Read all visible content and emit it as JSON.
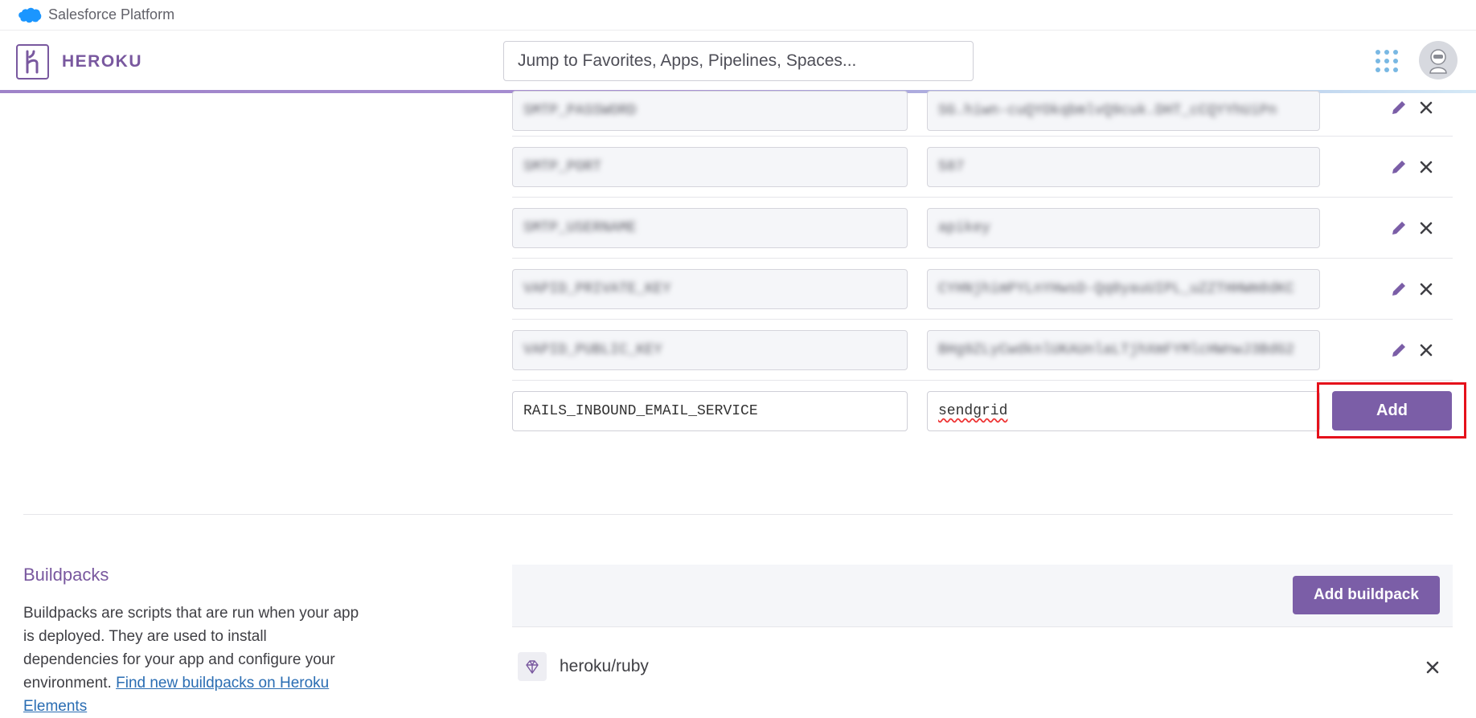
{
  "platform_bar": {
    "label": "Salesforce Platform",
    "icon": "salesforce-cloud-icon"
  },
  "header": {
    "brand": "HEROKU",
    "search_placeholder": "Jump to Favorites, Apps, Pipelines, Spaces...",
    "apps_icon": "apps-grid-icon",
    "avatar_icon": "user-avatar-icon"
  },
  "config_vars": {
    "rows": [
      {
        "key": "SMTP_PASSWORD",
        "value": "SG.hiwn-cuQYOkqbmlvQ9cuk.DHT_cCQYYhUiPn"
      },
      {
        "key": "SMTP_PORT",
        "value": "587"
      },
      {
        "key": "SMTP_USERNAME",
        "value": "apikey"
      },
      {
        "key": "VAPID_PRIVATE_KEY",
        "value": "CYHNjhimPYLnYHwsD-Qq0yauUIPL_uZZTHHWm8dKC"
      },
      {
        "key": "VAPID_PUBLIC_KEY",
        "value": "BHg9ZLyCwdknlUKAUnlaLTjhXmFYMlcHWnwJ3BdG2"
      }
    ],
    "new_key": "RAILS_INBOUND_EMAIL_SERVICE",
    "new_value": "sendgrid",
    "add_label": "Add",
    "edit_icon": "pencil-icon",
    "delete_icon": "close-icon"
  },
  "buildpacks": {
    "title": "Buildpacks",
    "description": "Buildpacks are scripts that are run when your app is deployed. They are used to install dependencies for your app and configure your environment.",
    "link_text": "Find new buildpacks on Heroku Elements",
    "add_label": "Add buildpack",
    "items": [
      {
        "name": "heroku/ruby",
        "icon": "ruby-icon"
      }
    ]
  },
  "colors": {
    "brand": "#79589f",
    "button": "#7b5ea7",
    "highlight": "#e5111b",
    "link": "#2a6db3"
  }
}
